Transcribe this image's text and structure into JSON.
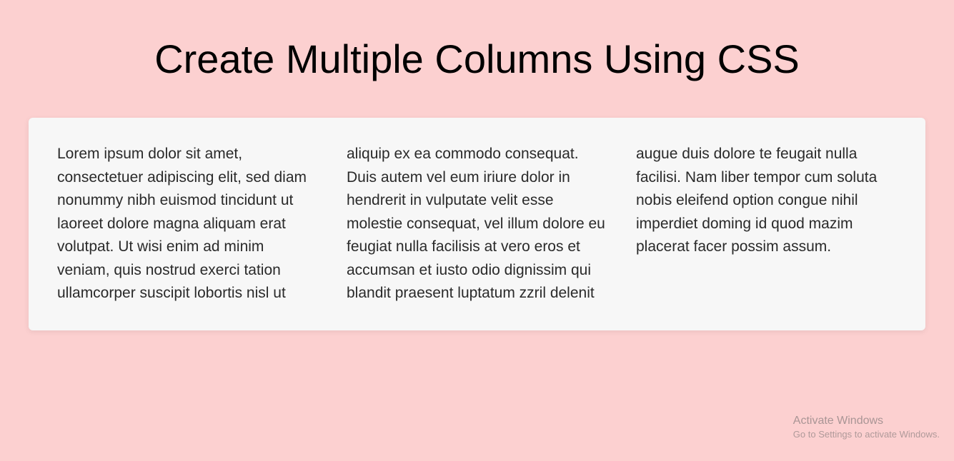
{
  "heading": "Create Multiple Columns Using CSS",
  "bodyText": "Lorem ipsum dolor sit amet, consectetuer adipiscing elit, sed diam nonummy nibh euismod tincidunt ut laoreet dolore magna aliquam erat volutpat. Ut wisi enim ad minim veniam, quis nostrud exerci tation ullamcorper suscipit lobortis nisl ut aliquip ex ea commodo consequat. Duis autem vel eum iriure dolor in hendrerit in vulputate velit esse molestie consequat, vel illum dolore eu feugiat nulla facilisis at vero eros et accumsan et iusto odio dignissim qui blandit praesent luptatum zzril delenit augue duis dolore te feugait nulla facilisi. Nam liber tempor cum soluta nobis eleifend option congue nihil imperdiet doming id quod mazim placerat facer possim assum.",
  "watermark": {
    "title": "Activate Windows",
    "subtitle": "Go to Settings to activate Windows."
  }
}
